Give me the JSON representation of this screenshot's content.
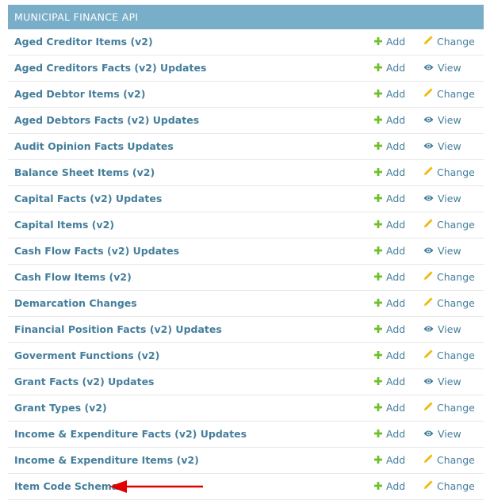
{
  "module": {
    "caption": "MUNICIPAL FINANCE API",
    "add_label": "Add",
    "rows": [
      {
        "title": "Aged Creditor Items (v2)",
        "action": "Change",
        "action_icon": "pencil-icon"
      },
      {
        "title": "Aged Creditors Facts (v2) Updates",
        "action": "View",
        "action_icon": "eye-icon"
      },
      {
        "title": "Aged Debtor Items (v2)",
        "action": "Change",
        "action_icon": "pencil-icon"
      },
      {
        "title": "Aged Debtors Facts (v2) Updates",
        "action": "View",
        "action_icon": "eye-icon"
      },
      {
        "title": "Audit Opinion Facts Updates",
        "action": "View",
        "action_icon": "eye-icon"
      },
      {
        "title": "Balance Sheet Items (v2)",
        "action": "Change",
        "action_icon": "pencil-icon"
      },
      {
        "title": "Capital Facts (v2) Updates",
        "action": "View",
        "action_icon": "eye-icon"
      },
      {
        "title": "Capital Items (v2)",
        "action": "Change",
        "action_icon": "pencil-icon"
      },
      {
        "title": "Cash Flow Facts (v2) Updates",
        "action": "View",
        "action_icon": "eye-icon"
      },
      {
        "title": "Cash Flow Items (v2)",
        "action": "Change",
        "action_icon": "pencil-icon"
      },
      {
        "title": "Demarcation Changes",
        "action": "Change",
        "action_icon": "pencil-icon"
      },
      {
        "title": "Financial Position Facts (v2) Updates",
        "action": "View",
        "action_icon": "eye-icon"
      },
      {
        "title": "Goverment Functions (v2)",
        "action": "Change",
        "action_icon": "pencil-icon"
      },
      {
        "title": "Grant Facts (v2) Updates",
        "action": "View",
        "action_icon": "eye-icon"
      },
      {
        "title": "Grant Types (v2)",
        "action": "Change",
        "action_icon": "pencil-icon"
      },
      {
        "title": "Income & Expenditure Facts (v2) Updates",
        "action": "View",
        "action_icon": "eye-icon"
      },
      {
        "title": "Income & Expenditure Items (v2)",
        "action": "Change",
        "action_icon": "pencil-icon"
      },
      {
        "title": "Item Code Schemas",
        "action": "Change",
        "action_icon": "pencil-icon"
      }
    ]
  },
  "colors": {
    "caption_bg": "#79aec8",
    "link": "#447e9b",
    "add_icon": "#70bf2b",
    "change_icon": "#efb80b",
    "view_icon": "#447e9b",
    "annotation_arrow": "#e00000"
  }
}
